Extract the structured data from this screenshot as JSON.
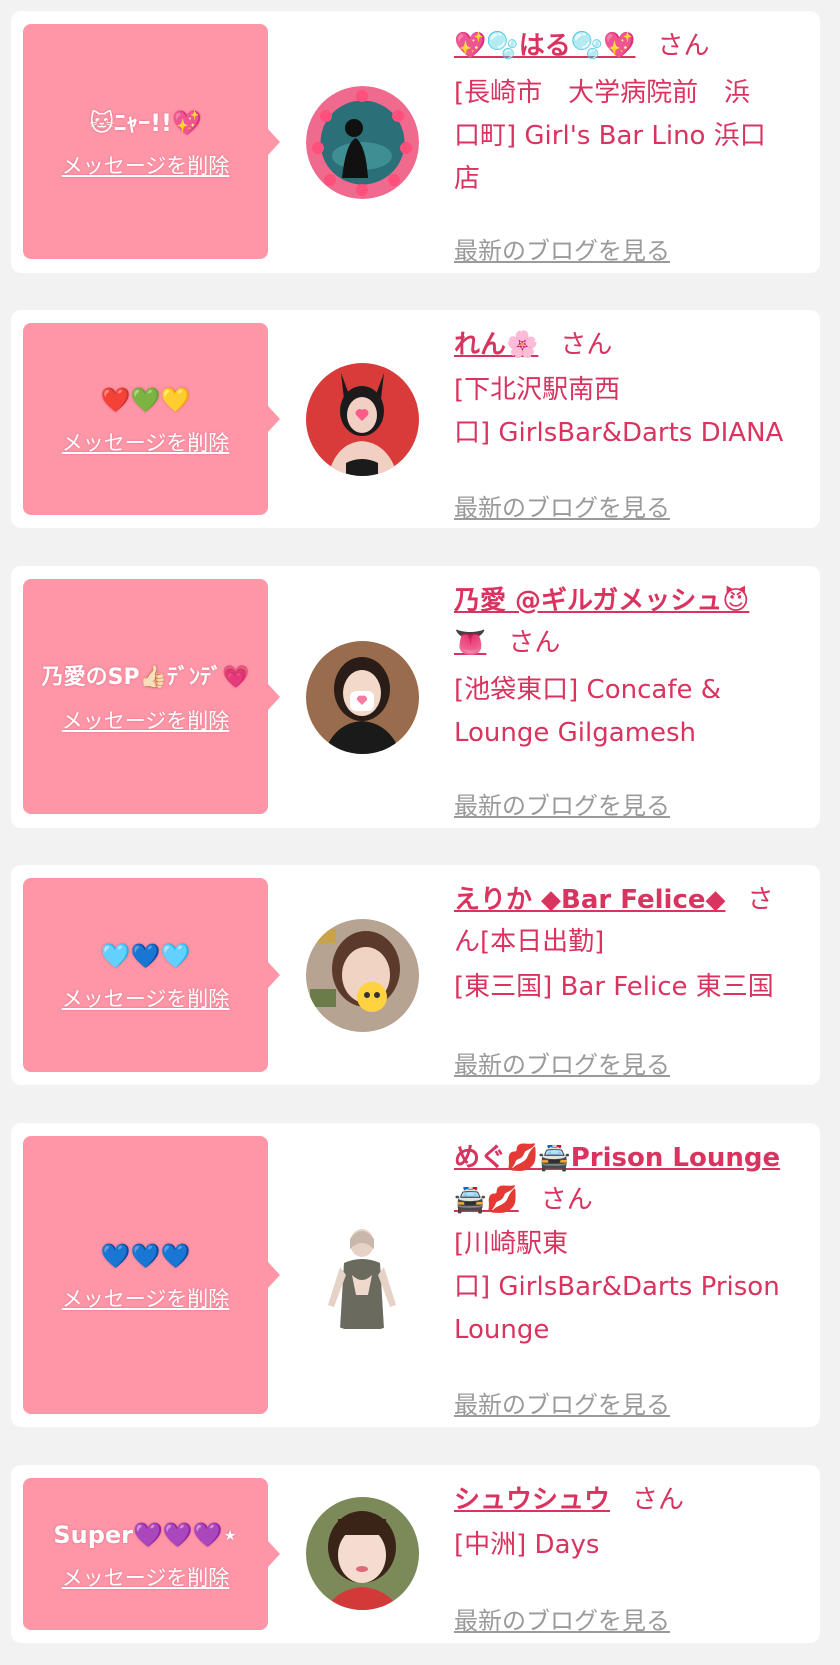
{
  "colors": {
    "bubble": "#ff96a8",
    "accent": "#d9335f",
    "blog_link": "#9a9a9a",
    "card": "#ffffff",
    "background": "#f2f2f2"
  },
  "delete_label": "メッセージを削除",
  "blog_label": "最新のブログを見る",
  "entries": [
    {
      "message": "🐱ﾆｬｰ!!💖",
      "name": "💖🫧はる🫧💖",
      "honorific": "さん",
      "shop_lines": [
        "[長崎市　大学病院前　浜",
        "口町] Girl's Bar Lino 浜口",
        "店"
      ]
    },
    {
      "message": "❤️💚💛",
      "name": "れん🌸",
      "honorific": "さん",
      "shop_lines": [
        "[下北沢駅南西",
        "口] GirlsBar&Darts DIANA"
      ]
    },
    {
      "message": "乃愛のSP👍🏻ﾃﾞﾝﾃﾞ💗",
      "name_lines": [
        "乃愛 @ギルガメッシュ😈",
        "👅"
      ],
      "honorific": "さん",
      "shop_lines": [
        "[池袋東口] Concafe &",
        "Lounge Gilgamesh"
      ]
    },
    {
      "message": "🩵💙🩵",
      "name": "えりか ◆Bar Felice◆",
      "honorific_lines": [
        "さ",
        "ん"
      ],
      "status": "[本日出勤]",
      "shop_lines": [
        "[東三国] Bar Felice 東三国"
      ]
    },
    {
      "message": "💙💙💙",
      "name_lines": [
        "めぐ💋🚔Prison Lounge",
        "🚔💋"
      ],
      "honorific": "さん",
      "shop_lines": [
        "[川崎駅東",
        "口] GirlsBar&Darts Prison",
        "Lounge"
      ]
    },
    {
      "message": "Super💜💜💜⋆",
      "name": "シュウシュウ",
      "honorific": "さん",
      "shop_lines": [
        "[中洲] Days"
      ]
    }
  ]
}
